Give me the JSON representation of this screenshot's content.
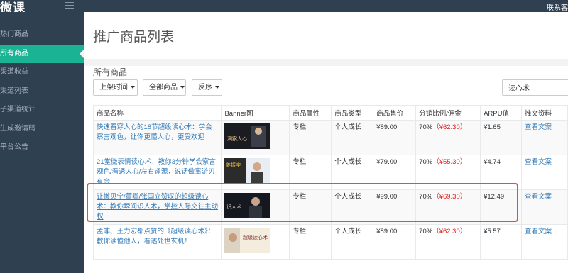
{
  "topbar": {
    "logo": "微课",
    "contact": "联系客"
  },
  "sidebar": {
    "items": [
      {
        "label": "热门商品"
      },
      {
        "label": "所有商品"
      },
      {
        "label": "渠道收益"
      },
      {
        "label": "渠道列表"
      },
      {
        "label": "子渠道统计"
      },
      {
        "label": "生成邀请码"
      },
      {
        "label": "平台公告"
      }
    ],
    "active_index": 1
  },
  "page": {
    "title": "推广商品列表",
    "section": "所有商品"
  },
  "filters": {
    "time": "上架时间",
    "all": "全部商品",
    "order": "反序",
    "search_value": "读心术"
  },
  "table": {
    "headers": [
      "商品名称",
      "Banner图",
      "商品属性",
      "商品类型",
      "商品售价",
      "分销比例/佣金",
      "ARPU值",
      "推文资料"
    ],
    "rows": [
      {
        "name": "快速看穿人心的18节超级读心术：学会察言观色，让你更懂人心，更受欢迎",
        "attr": "专栏",
        "type": "个人成长",
        "price": "¥89.00",
        "ratio": "70%",
        "commission": "（¥62.30）",
        "arpu": "¥1.65",
        "action": "查看文案",
        "banner_text": "洞察人心"
      },
      {
        "name": "21堂微表情读心术：教你3分钟学会察言观色/看透人心/左右逢源，说话做事游刃有余",
        "attr": "专栏",
        "type": "个人成长",
        "price": "¥79.00",
        "ratio": "70%",
        "commission": "（¥55.30）",
        "arpu": "¥4.74",
        "action": "查看文案",
        "banner_text": "姜振宇"
      },
      {
        "name": "让撒贝宁/董卿/张国立赞叹的超级读心术：教你瞬间识人术，掌控人际交往主动权",
        "attr": "专栏",
        "type": "个人成长",
        "price": "¥99.00",
        "ratio": "70%",
        "commission": "（¥69.30）",
        "arpu": "¥12.49",
        "action": "查看文案",
        "banner_text": "识人术"
      },
      {
        "name": "孟非、王力宏都点赞的《超级读心术》：教你读懂他人，看透处世玄机！",
        "attr": "专栏",
        "type": "个人成长",
        "price": "¥89.00",
        "ratio": "70%",
        "commission": "（¥62.30）",
        "arpu": "¥5.57",
        "action": "查看文案",
        "banner_text": "超级读心术"
      }
    ]
  },
  "colors": {
    "sidebar_bg": "#2f4050",
    "active": "#1ab394",
    "link": "#337ab7",
    "commission": "#e02020",
    "highlight": "#e0503a"
  }
}
